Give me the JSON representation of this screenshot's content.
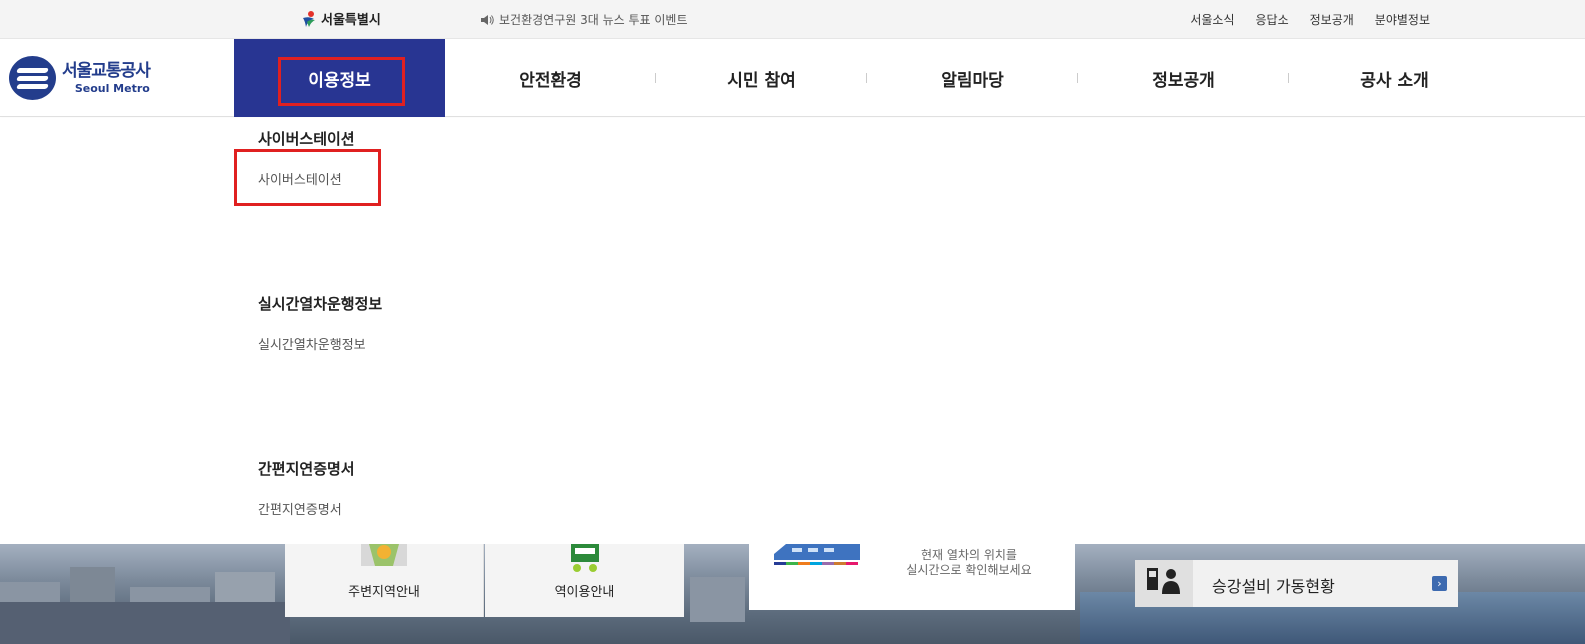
{
  "topbar": {
    "seoul_logo_text": "서울특별시",
    "notice": "보건환경연구원 3대 뉴스 투표 이벤트",
    "util_links": [
      "서울소식",
      "응답소",
      "정보공개",
      "분야별정보"
    ]
  },
  "brand": {
    "name_ko": "서울교통공사",
    "name_en": "Seoul Metro"
  },
  "gnb": {
    "items": [
      {
        "label": "이용정보",
        "active": true
      },
      {
        "label": "안전환경"
      },
      {
        "label": "시민 참여"
      },
      {
        "label": "알림마당"
      },
      {
        "label": "정보공개"
      },
      {
        "label": "공사 소개"
      }
    ]
  },
  "dropdown": {
    "groups": [
      {
        "title": "사이버스테이션",
        "links": [
          "사이버스테이션"
        ]
      },
      {
        "title": "실시간열차운행정보",
        "links": [
          "실시간열차운행정보"
        ]
      },
      {
        "title": "간편지연증명서",
        "links": [
          "간편지연증명서"
        ]
      }
    ]
  },
  "quick": {
    "nearby": "주변지역안내",
    "station": "역이용안내",
    "train_desc_1": "현재 열차의 위치를",
    "train_desc_2": "실시간으로 확인해보세요",
    "facility": "승강설비 가동현황",
    "facility_arrow": "›"
  },
  "colors": {
    "active_menu": "#283592",
    "highlight": "#e02020",
    "brand": "#233d8c"
  }
}
